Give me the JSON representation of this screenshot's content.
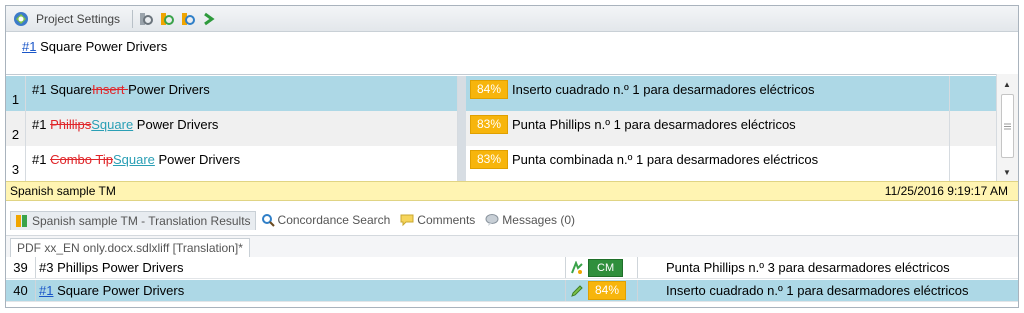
{
  "toolbar": {
    "project_settings_label": "Project Settings",
    "icons": [
      "project-settings-icon",
      "tm-settings-icon",
      "tm-update-icon",
      "tm-lookup-icon",
      "run-icon"
    ]
  },
  "source_line": {
    "tag": "#1",
    "text": " Square Power Drivers"
  },
  "tm_results": [
    {
      "num": "1",
      "source": [
        {
          "t": "#1 Square",
          "s": "plain"
        },
        {
          "t": "Insert ",
          "s": "del"
        },
        {
          "t": "Power Drivers",
          "s": "plain"
        }
      ],
      "score": "84%",
      "target": "Inserto cuadrado n.º 1 para desarmadores eléctricos"
    },
    {
      "num": "2",
      "source": [
        {
          "t": "#1 ",
          "s": "plain"
        },
        {
          "t": "Phillips",
          "s": "del"
        },
        {
          "t": "Square",
          "s": "ins"
        },
        {
          "t": " Power Drivers",
          "s": "plain"
        }
      ],
      "score": "83%",
      "target": "Punta Phillips n.º 1 para desarmadores eléctricos"
    },
    {
      "num": "3",
      "source": [
        {
          "t": "#1 ",
          "s": "plain"
        },
        {
          "t": "Combo Tip",
          "s": "del"
        },
        {
          "t": "Square",
          "s": "ins"
        },
        {
          "t": " Power Drivers",
          "s": "plain"
        }
      ],
      "score": "83%",
      "target": "Punta combinada n.º 1 para desarmadores eléctricos"
    }
  ],
  "status_bar": {
    "tm_name": "Spanish sample TM",
    "timestamp": "11/25/2016 9:19:17 AM"
  },
  "tabs": [
    {
      "label": "Spanish sample TM - Translation Results",
      "icon": "translation-results-icon"
    },
    {
      "label": "Concordance Search",
      "icon": "concordance-search-icon"
    },
    {
      "label": "Comments",
      "icon": "comments-icon"
    },
    {
      "label": "Messages (0)",
      "icon": "messages-icon"
    }
  ],
  "document_tab": "PDF xx_EN only.docx.sdlxliff [Translation]*",
  "segments": [
    {
      "num": "39",
      "source": "#3 Phillips Power Drivers",
      "status": "CM",
      "status_icon": "tm-match-icon",
      "target": "Punta Phillips n.º 3 para desarmadores eléctricos"
    },
    {
      "num": "40",
      "source_tag": "#1",
      "source": " Square Power Drivers",
      "status": "84%",
      "status_icon": "pencil-icon",
      "target": "Inserto cuadrado n.º 1 para desarmadores eléctricos"
    }
  ],
  "colors": {
    "selected_row": "#add8e6",
    "fuzzy_score": "#f7b50c",
    "context_match": "#2f8f3c",
    "deletion": "#e0262a",
    "insertion": "#2a9fb5",
    "status_bar": "#fff4b2"
  }
}
